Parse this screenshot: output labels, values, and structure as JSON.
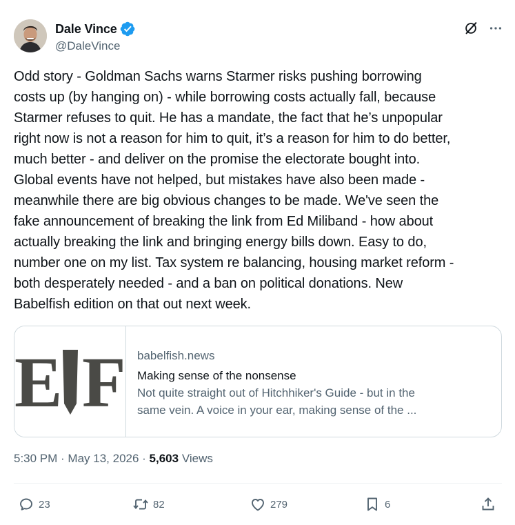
{
  "author": {
    "name": "Dale Vince",
    "handle": "@DaleVince"
  },
  "tweet": {
    "text": "Odd story - Goldman Sachs warns Starmer risks pushing borrowing\ncosts up (by hanging on) - while borrowing costs actually fall, because\nStarmer refuses to quit. He has a mandate, the fact that he’s unpopular\nright now is not a reason for him to quit, it’s a reason for him to do better,\nmuch better - and deliver on the promise the electorate bought into.\nGlobal events have not helped, but mistakes have also been made -\nmeanwhile there are big obvious changes to be made. We've seen the\nfake announcement of breaking the link from Ed Miliband - how about\nactually breaking the link and bringing energy bills down. Easy to do,\nnumber one on my list. Tax system re balancing, housing market reform -\nboth desperately needed - and a ban on political donations. New\nBabelfish edition on that out next week."
  },
  "link_card": {
    "domain": "babelfish.news",
    "title": "Making sense of the nonsense",
    "description_line1": "Not quite straight out of Hitchhiker's Guide - but in the",
    "description_line2": "same vein. A voice in your ear, making sense of the ...",
    "thumbnail_letters": "EIF"
  },
  "meta": {
    "time": "5:30 PM",
    "sep1": " · ",
    "date": "May 13, 2026",
    "sep2": " · ",
    "views_count": "5,603",
    "views_label": " Views"
  },
  "actions": {
    "replies": "23",
    "reposts": "82",
    "likes": "279",
    "bookmarks": "6"
  },
  "colors": {
    "verified_blue": "#1d9bf0",
    "text_primary": "#0f1419",
    "text_secondary": "#536471",
    "border": "#cfd9de"
  },
  "icons": {
    "verified": "verified-badge-icon",
    "grok": "grok-icon",
    "more": "more-icon",
    "reply": "reply-icon",
    "repost": "repost-icon",
    "like": "heart-icon",
    "bookmark": "bookmark-icon",
    "share": "share-icon"
  }
}
